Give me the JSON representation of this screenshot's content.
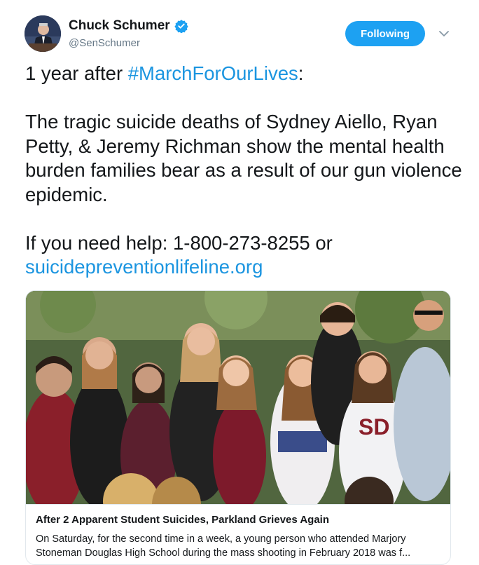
{
  "author": {
    "name": "Chuck Schumer",
    "handle": "@SenSchumer",
    "verified": true,
    "avatar_icon": "avatar-photo"
  },
  "follow_button": {
    "label": "Following"
  },
  "menu": {
    "icon": "chevron-down-icon"
  },
  "tweet": {
    "line1_prefix": "1 year after ",
    "hashtag": "#MarchForOurLives",
    "line1_suffix": ":",
    "paragraph2": "The tragic suicide deaths of Sydney Aiello, Ryan Petty, & Jeremy Richman show the mental health burden families bear as a result of our gun violence epidemic.",
    "help_prefix": "If you need help: 1-800-273-8255 or",
    "help_link": "suicidepreventionlifeline.org"
  },
  "card": {
    "image_icon": "crowd-photo",
    "title": "After 2 Apparent Student Suicides, Parkland Grieves Again",
    "description": "On Saturday, for the second time in a week, a young person who attended Marjory Stoneman Douglas High School during the mass shooting in February 2018 was f..."
  },
  "colors": {
    "accent": "#1da1f2",
    "link": "#1b95e0",
    "text": "#14171a",
    "muted": "#657786",
    "border": "#e1e8ed"
  }
}
